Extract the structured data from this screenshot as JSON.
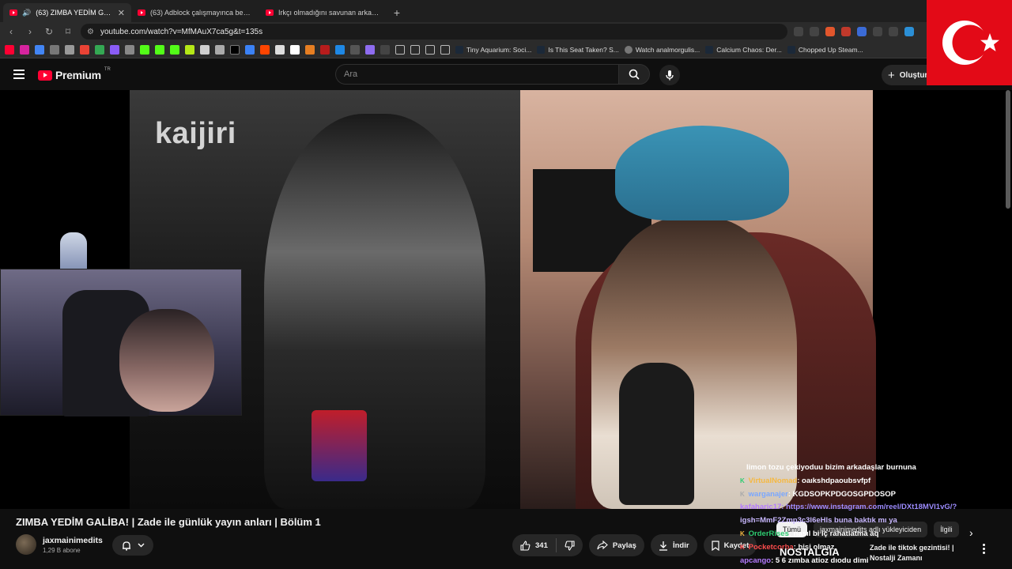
{
  "tabs": [
    {
      "label": "(63) ZIMBA YEDİM GALİBA! |",
      "active": true
    },
    {
      "label": "(63) Adblock çalışmayınca ben - You",
      "active": false
    },
    {
      "label": "Irkçı olmadığını savunan arkadaşım",
      "active": false
    }
  ],
  "address_bar": {
    "url": "youtube.com/watch?v=MfMAuX7ca5g&t=135s"
  },
  "bookmarks": [
    {
      "label": "Tiny Aquarium: Soci..."
    },
    {
      "label": "Is This Seat Taken? S..."
    },
    {
      "label": "Watch analmorgulis..."
    },
    {
      "label": "Calcium Chaos: Der..."
    },
    {
      "label": "Chopped Up Steam..."
    }
  ],
  "masthead": {
    "brand": "Premium",
    "region": "TR",
    "search_placeholder": "Ara",
    "create_label": "Oluştur"
  },
  "video": {
    "watermark": "kaijiri"
  },
  "chat": [
    {
      "user": "",
      "message": "limon tozu çekiyoduu bizim arkadaşlar burnuna",
      "user_color": "#ff4d4d",
      "link": false
    },
    {
      "user": "VirtualNomad",
      "message": ": oaıkshdpaoubsvfpf",
      "user_color": "#f5b841",
      "link": false
    },
    {
      "user": "warganajer",
      "message": ": KGDSOPKPDGOSGPDOSOP",
      "user_color": "#7aa7ff",
      "link": false
    },
    {
      "user": "kafaharic17",
      "message": ": https://www.instagram.com/reel/DXt18MVI1vG/?",
      "user_color": "#b47aff",
      "link": true
    },
    {
      "user": "",
      "message": "igsh=MmF2Zmp3c3l6eHls buna baktık mı ya",
      "user_color": "#ffffff",
      "link": false
    },
    {
      "user": "OrderRises",
      "message": ": nasıl bi iç rahatlatma aq",
      "user_color": "#2ecc71",
      "link": false
    },
    {
      "user": "Pocketcorba",
      "message": ": bişi olmaz",
      "user_color": "#ff4d4d",
      "link": false
    },
    {
      "user": "apcango",
      "message": ": 5 6 zımba atioz dıodu dimi",
      "user_color": "#b47aff",
      "link": false
    }
  ],
  "nostalgia_overlay": "NOSTALGIA",
  "details": {
    "title": "ZIMBA YEDİM GALİBA! | Zade ile günlük yayın anları | Bölüm 1",
    "channel": "jaxmainimedits",
    "subscribers": "1,29 B abone",
    "likes": "341",
    "share_label": "Paylaş",
    "download_label": "İndir",
    "save_label": "Kaydet"
  },
  "sidebar": {
    "chips": [
      {
        "label": "Tümü",
        "active": true
      },
      {
        "label": "jaxmainimedits adlı yükleyiciden",
        "active": false
      },
      {
        "label": "İlgili",
        "active": false
      }
    ],
    "recommendation_title": "Zade ile tiktok gezintisi! | Nostalji Zamanı"
  },
  "colors": {
    "youtube_red": "#ff0033",
    "flag_red": "#e30a17",
    "background": "#0f0f0f"
  }
}
